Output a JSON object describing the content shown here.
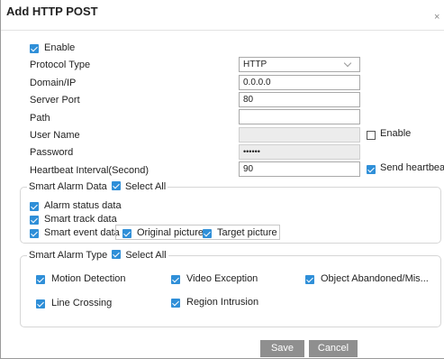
{
  "dialog": {
    "title": "Add HTTP POST",
    "close_glyph": "×"
  },
  "form": {
    "enable_label": "Enable",
    "protocol_type_label": "Protocol Type",
    "protocol_type_value": "HTTP",
    "domain_label": "Domain/IP",
    "domain_value": "0.0.0.0",
    "port_label": "Server Port",
    "port_value": "80",
    "path_label": "Path",
    "path_value": "",
    "username_label": "User Name",
    "username_value": "",
    "auth_enable_label": "Enable",
    "password_label": "Password",
    "password_value": "••••••",
    "heartbeat_label": "Heartbeat Interval(Second)",
    "heartbeat_value": "90",
    "send_heartbeat_label": "Send heartbeat"
  },
  "smart_alarm_data": {
    "legend": "Smart Alarm Data",
    "select_all": "Select All",
    "items": [
      "Alarm status data",
      "Smart track data",
      "Smart event data"
    ],
    "picture_options": [
      "Original picture",
      "Target picture"
    ]
  },
  "smart_alarm_type": {
    "legend": "Smart Alarm Type",
    "select_all": "Select All",
    "items": [
      "Motion Detection",
      "Video Exception",
      "Object Abandoned/Mis...",
      "Line Crossing",
      "Region Intrusion"
    ]
  },
  "buttons": {
    "save": "Save",
    "cancel": "Cancel"
  },
  "colors": {
    "checkbox": "#2f8fd8",
    "button": "#8f8f8f",
    "border": "#d6d6d6"
  }
}
